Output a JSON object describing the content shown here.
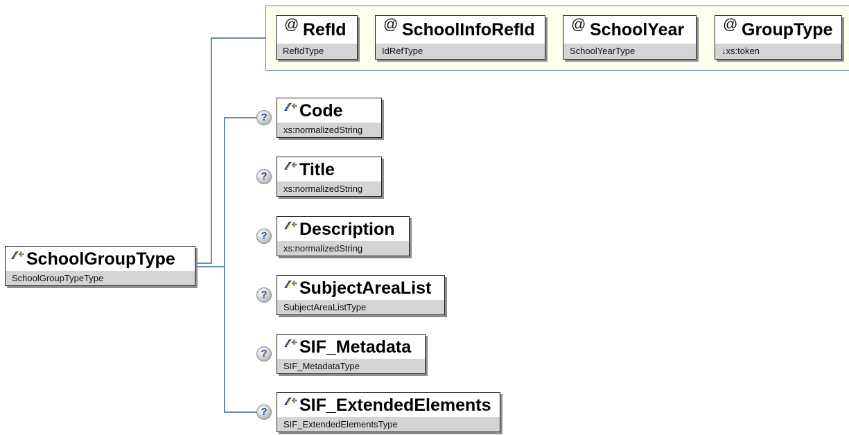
{
  "diagram": {
    "root": {
      "icon": "element-icon",
      "name": "SchoolGroupType",
      "type": "SchoolGroupTypeType"
    },
    "attributes": [
      {
        "marker": "@",
        "name": "RefId",
        "type": "RefIdType"
      },
      {
        "marker": "@",
        "name": "SchoolInfoRefId",
        "type": "IdRefType"
      },
      {
        "marker": "@",
        "name": "SchoolYear",
        "type": "SchoolYearType"
      },
      {
        "marker": "@",
        "name": "GroupType",
        "type": "↓xs:token"
      }
    ],
    "children": [
      {
        "optional_marker": "?",
        "icon": "element-icon",
        "name": "Code",
        "type": "xs:normalizedString"
      },
      {
        "optional_marker": "?",
        "icon": "element-icon",
        "name": "Title",
        "type": "xs:normalizedString"
      },
      {
        "optional_marker": "?",
        "icon": "element-icon",
        "name": "Description",
        "type": "xs:normalizedString"
      },
      {
        "optional_marker": "?",
        "icon": "element-icon",
        "name": "SubjectAreaList",
        "type": "SubjectAreaListType"
      },
      {
        "optional_marker": "?",
        "icon": "element-icon",
        "name": "SIF_Metadata",
        "type": "SIF_MetadataType"
      },
      {
        "optional_marker": "?",
        "icon": "element-icon",
        "name": "SIF_ExtendedElements",
        "type": "SIF_ExtendedElementsType"
      }
    ]
  },
  "colors": {
    "connector": "#3a63a6",
    "attribute_panel_background": "#fffff0",
    "attribute_panel_border": "#5a80b8",
    "type_bar": "#d4d4d4",
    "element_icon_blue": "#1c3f94",
    "element_icon_yellow": "#f0c800",
    "optional_marker_text": "#24508f"
  }
}
